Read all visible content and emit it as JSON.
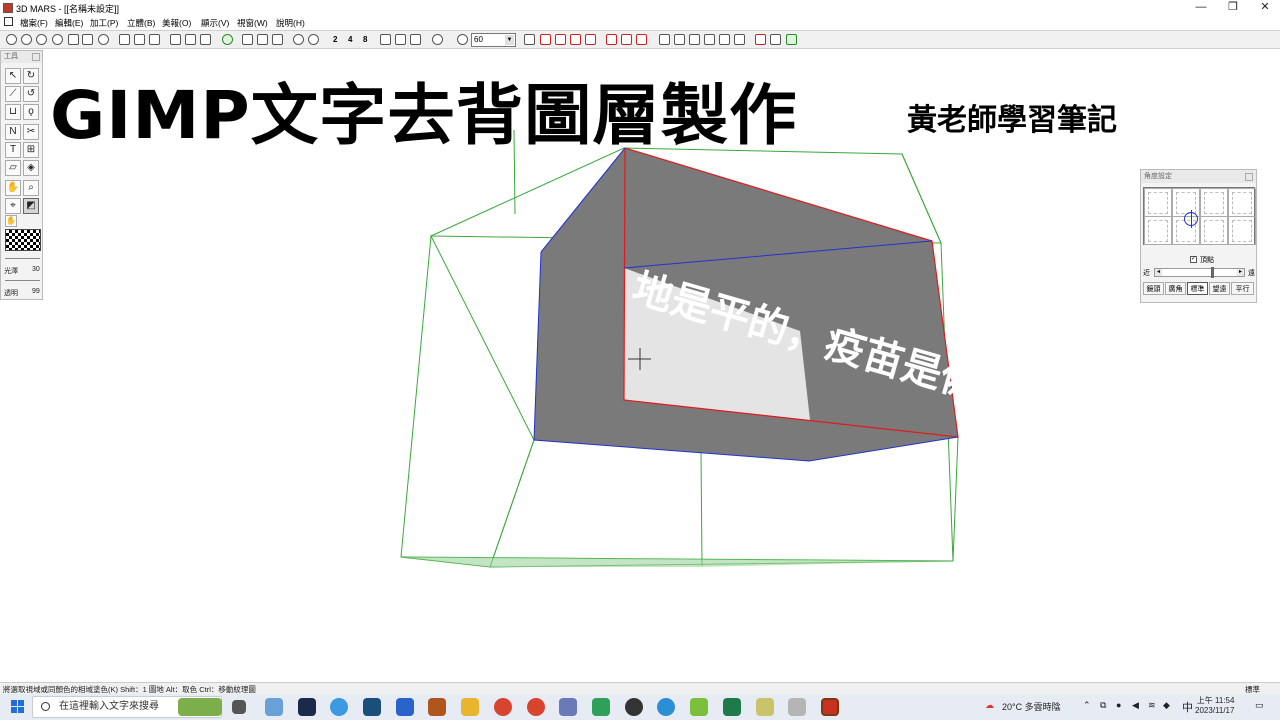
{
  "window": {
    "title": "3D MARS - [[名稱未設定]]",
    "minimize": "—",
    "maximize": "❐",
    "close": "✕"
  },
  "menu": [
    "檔案(F)",
    "編輯(E)",
    "加工(P)",
    "立體(B)",
    "美報(O)",
    "顯示(V)",
    "視窗(W)",
    "說明(H)"
  ],
  "toolbar": {
    "nums": [
      "2",
      "4",
      "8"
    ],
    "zoom_value": "60"
  },
  "tool_panel": {
    "title": "工具",
    "gloss_label": "光澤",
    "gloss_value": "30",
    "opacity_label": "透明",
    "opacity_value": "99"
  },
  "overlay": {
    "headline": "GIMP文字去背圖層製作",
    "author": "黃老師學習筆記"
  },
  "scene_text": "地是平的，疫苗是偽科學",
  "angle_panel": {
    "title": "角度設定",
    "checkbox_label": "頂點",
    "near_label": "近",
    "far_label": "遠",
    "tabs": [
      "鏡頭",
      "廣角",
      "標準",
      "望遠",
      "平行"
    ],
    "active_tab": "標準"
  },
  "status": {
    "text": "將選取視域或同顏色的相域塗色(K)   Shift：1 圖地   Alt：取色   Ctrl：移動紋理圖",
    "right": "標準"
  },
  "taskbar": {
    "search_placeholder": "在這裡輸入文字來搜尋",
    "weather": "20°C  多雲時陰",
    "ime": "中",
    "time": "上午 11:54",
    "date": "2023/11/17"
  }
}
